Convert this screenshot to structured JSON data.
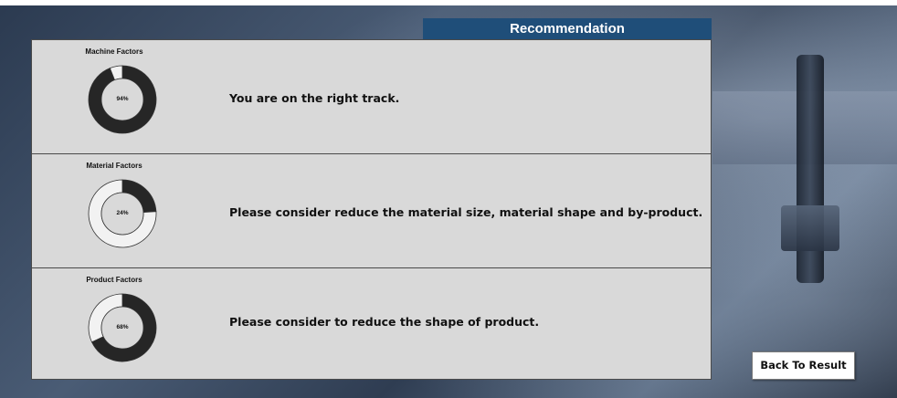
{
  "header": {
    "title": "Recommendation"
  },
  "factors": [
    {
      "title": "Machine Factors",
      "percent": 94,
      "label": "94%",
      "message": "You are on the right track."
    },
    {
      "title": "Material Factors",
      "percent": 24,
      "label": "24%",
      "message": "Please consider reduce the material size, material shape and by-product."
    },
    {
      "title": "Product Factors",
      "percent": 68,
      "label": "68%",
      "message": "Please consider to reduce the shape of product."
    }
  ],
  "back_button": {
    "label": "Back To Result"
  },
  "colors": {
    "header_bg": "#1f4e79",
    "donut_filled": "#262626",
    "donut_empty": "#f2f2f2",
    "panel_bg": "#d9d9d9"
  }
}
